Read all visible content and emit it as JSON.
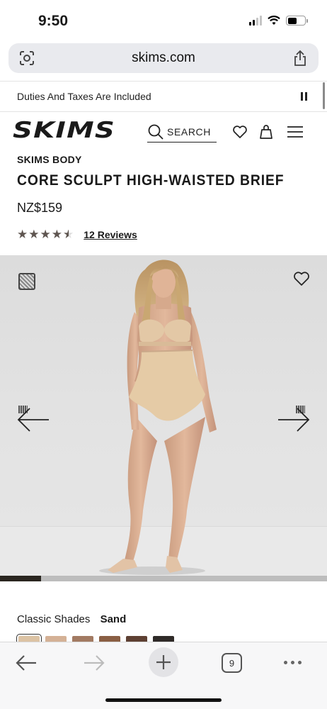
{
  "status_bar": {
    "time": "9:50"
  },
  "browser": {
    "url": "skims.com",
    "tabs_count": "9"
  },
  "announcement": {
    "text": "Duties And Taxes Are Included"
  },
  "header": {
    "logo": "SKIMS",
    "search_label": "SEARCH"
  },
  "product": {
    "brand": "SKIMS BODY",
    "title": "CORE SCULPT HIGH-WAISTED BRIEF",
    "price": "NZ$159",
    "rating": 4.5,
    "reviews_label": "12 Reviews"
  },
  "gallery": {
    "progress_fraction": 0.125
  },
  "shades": {
    "group_label": "Classic Shades",
    "selected": "Sand",
    "swatch_colors": [
      "#dcc3a4",
      "#d4b196",
      "#a27a62",
      "#8a5f44",
      "#5e4033",
      "#2f2a28"
    ]
  },
  "icons": [
    "lens-icon",
    "share-icon",
    "pause-icon",
    "search-icon",
    "heart-icon",
    "bag-icon",
    "menu-icon",
    "arrow-left-icon",
    "arrow-right-icon",
    "back-icon",
    "forward-icon",
    "plus-icon",
    "tabs-icon",
    "more-icon"
  ]
}
